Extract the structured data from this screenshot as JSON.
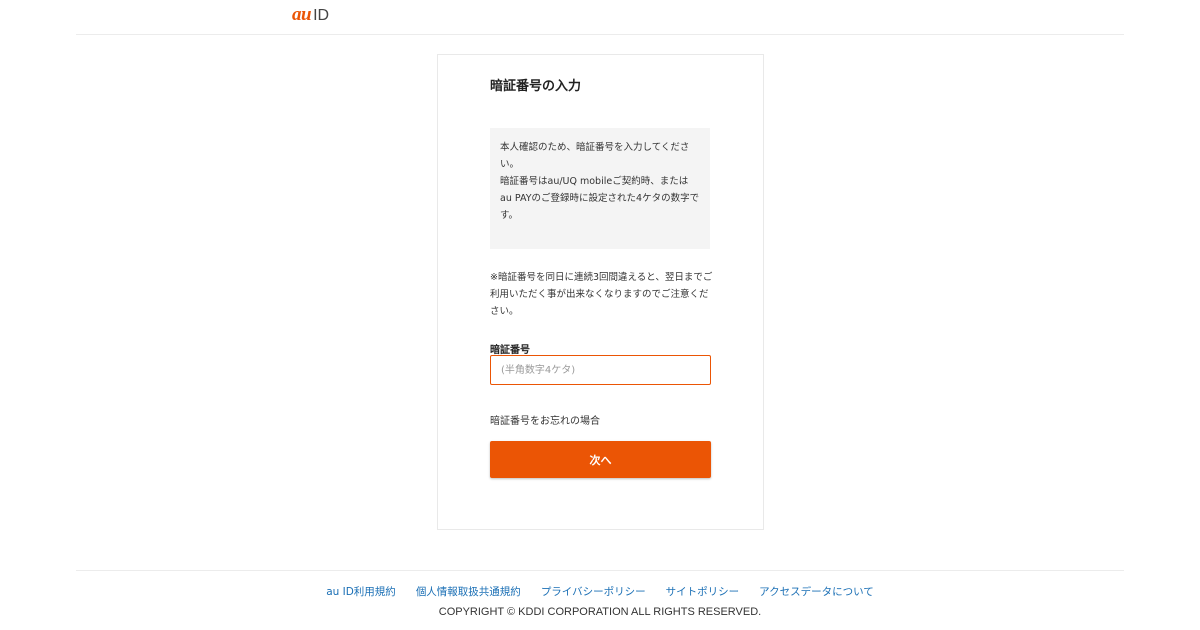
{
  "header": {
    "logo_au": "au",
    "logo_id": "ID"
  },
  "page": {
    "title": "暗証番号の入力",
    "info_lines": [
      "本人確認のため、暗証番号を入力してください。",
      "暗証番号はau/UQ mobileご契約時、または au PAYのご登録時に設定された4ケタの数字です。"
    ],
    "warning": "※暗証番号を同日に連続3回間違えると、翌日までご利用いただく事が出来なくなりますのでご注意ください。",
    "field_label": "暗証番号",
    "input_placeholder": "(半角数字4ケタ)",
    "input_value": "",
    "forgot_link": "暗証番号をお忘れの場合",
    "next_button": "次へ"
  },
  "footer": {
    "links": [
      "au ID利用規約",
      "個人情報取扱共通規約",
      "プライバシーポリシー",
      "サイトポリシー",
      "アクセスデータについて"
    ],
    "copyright": "COPYRIGHT © KDDI CORPORATION ALL RIGHTS RESERVED."
  },
  "colors": {
    "accent": "#eb5505",
    "link": "#1a6fb5",
    "info_background": "#f4f4f4"
  }
}
